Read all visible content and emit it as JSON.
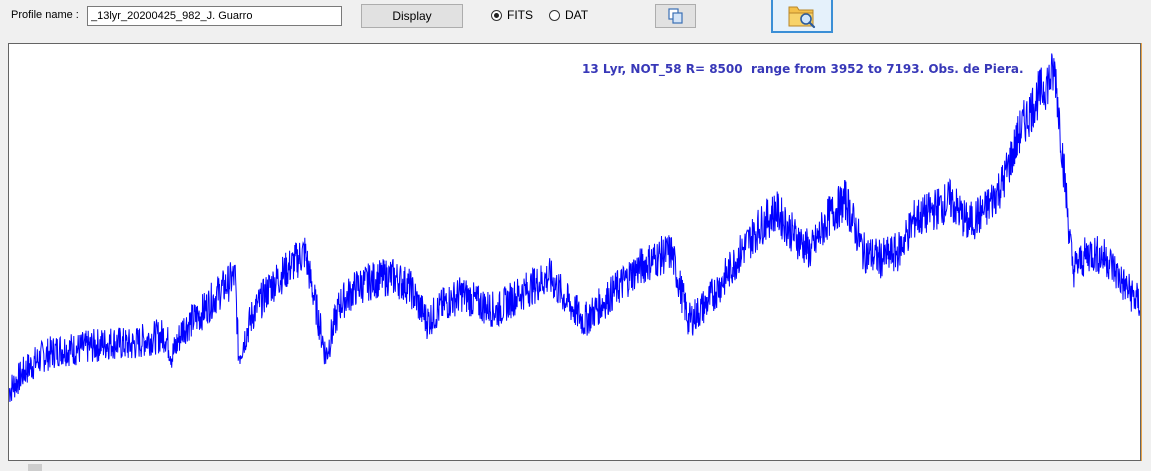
{
  "toolbar": {
    "profile_label": "Profile name :",
    "profile_value": "_13lyr_20200425_982_J. Guarro",
    "display_label": "Display",
    "format_options": [
      {
        "label": "FITS",
        "checked": true
      },
      {
        "label": "DAT",
        "checked": false
      }
    ],
    "copy_icon": "copy-icon",
    "open_icon": "folder-search-icon"
  },
  "plot": {
    "title": "13 Lyr, NOT_58 R= 8500  range from 3952 to 7193. Obs. de Piera.",
    "line_color": "#0000ff",
    "title_color": "#3838b8"
  },
  "chart_data": {
    "type": "line",
    "title": "13 Lyr, NOT_58 R= 8500  range from 3952 to 7193. Obs. de Piera.",
    "xlabel": "",
    "ylabel": "",
    "xlim": [
      3952,
      7193
    ],
    "ylim": [
      0,
      1.2
    ],
    "grid": false,
    "series": [
      {
        "color": "#0000ff",
        "x": [
          3952,
          4000,
          4050,
          4100,
          4150,
          4200,
          4250,
          4300,
          4350,
          4400,
          4420,
          4450,
          4500,
          4550,
          4600,
          4610,
          4650,
          4700,
          4750,
          4800,
          4860,
          4900,
          4950,
          5000,
          5050,
          5100,
          5150,
          5200,
          5250,
          5300,
          5350,
          5400,
          5450,
          5500,
          5550,
          5600,
          5650,
          5700,
          5750,
          5800,
          5850,
          5900,
          5950,
          6000,
          6050,
          6100,
          6150,
          6200,
          6250,
          6300,
          6350,
          6400,
          6450,
          6500,
          6550,
          6563,
          6600,
          6650,
          6700,
          6750,
          6800,
          6850,
          6900,
          6950,
          7000,
          7050,
          7100,
          7150,
          7193
        ],
        "y": [
          0.2,
          0.26,
          0.3,
          0.32,
          0.32,
          0.33,
          0.34,
          0.33,
          0.35,
          0.36,
          0.3,
          0.38,
          0.42,
          0.48,
          0.53,
          0.3,
          0.42,
          0.5,
          0.55,
          0.6,
          0.3,
          0.45,
          0.5,
          0.52,
          0.53,
          0.5,
          0.4,
          0.45,
          0.48,
          0.45,
          0.43,
          0.47,
          0.5,
          0.53,
          0.46,
          0.4,
          0.45,
          0.5,
          0.55,
          0.58,
          0.6,
          0.4,
          0.45,
          0.52,
          0.6,
          0.67,
          0.72,
          0.65,
          0.6,
          0.7,
          0.75,
          0.6,
          0.58,
          0.6,
          0.7,
          0.7,
          0.72,
          0.75,
          0.68,
          0.72,
          0.8,
          0.95,
          1.05,
          1.12,
          0.55,
          0.6,
          0.58,
          0.5,
          0.45
        ]
      }
    ]
  }
}
